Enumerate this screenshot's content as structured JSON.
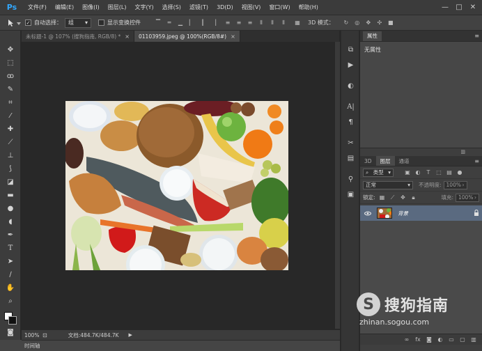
{
  "app": {
    "logo": "Ps"
  },
  "menu": [
    "文件(F)",
    "编辑(E)",
    "图像(I)",
    "图层(L)",
    "文字(Y)",
    "选择(S)",
    "滤镜(T)",
    "3D(D)",
    "视图(V)",
    "窗口(W)",
    "帮助(H)"
  ],
  "window_controls": {
    "minimize": "—",
    "maximize": "□",
    "close": "✕"
  },
  "options": {
    "auto_select_label": "自动选择：",
    "auto_select_checked": true,
    "auto_select_value": "组",
    "show_transform_label": "显示变换控件",
    "show_transform_checked": false,
    "mode_3d_label": "3D 模式："
  },
  "tabs": [
    {
      "label": "未标题-1 @ 107% (搜狗指南, RGB/8) *",
      "active": false
    },
    {
      "label": "01103959.jpeg @ 100%(RGB/8#)",
      "active": true
    }
  ],
  "status": {
    "zoom": "100%",
    "doc_info": "文档:484.7K/484.7K"
  },
  "timeline_label": "时间轴",
  "properties": {
    "tab": "属性",
    "body": "无属性"
  },
  "layers_panel": {
    "tabs": [
      "3D",
      "图层",
      "通道"
    ],
    "active_tab": "图层",
    "kind_label": "类型",
    "blend_mode": "正常",
    "opacity_label": "不透明度:",
    "opacity_value": "100%",
    "lock_label": "锁定:",
    "fill_label": "填充:",
    "fill_value": "100%",
    "layers": [
      {
        "name": "背景",
        "visible": true,
        "locked": true
      }
    ]
  },
  "watermark": {
    "logo_letter": "S",
    "title": "搜狗指南",
    "url": "zhinan.sogou.com"
  }
}
